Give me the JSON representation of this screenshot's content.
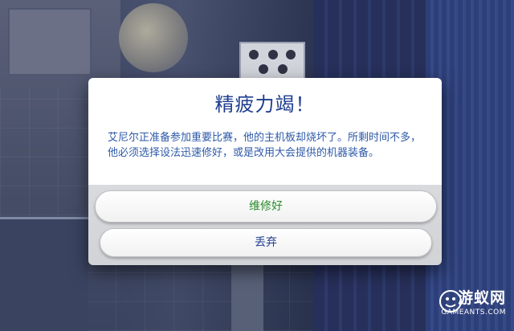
{
  "dialog": {
    "title": "精疲力竭！",
    "body": "艾尼尔正准备参加重要比赛，他的主机板却烧坏了。所剩时间不多，他必须选择设法迅速修好，或是改用大会提供的机器装备。",
    "options": [
      {
        "label": "维修好",
        "color": "#2b8a2b"
      },
      {
        "label": "丢弃",
        "color": "#1f3f8f"
      }
    ]
  },
  "watermark": {
    "title": "游蚁网",
    "subtitle": "GAMEANTS.COM"
  },
  "colors": {
    "title_text": "#1e3d8f",
    "body_text": "#2e5aa8",
    "dialog_bottom": "#d9dadd"
  }
}
